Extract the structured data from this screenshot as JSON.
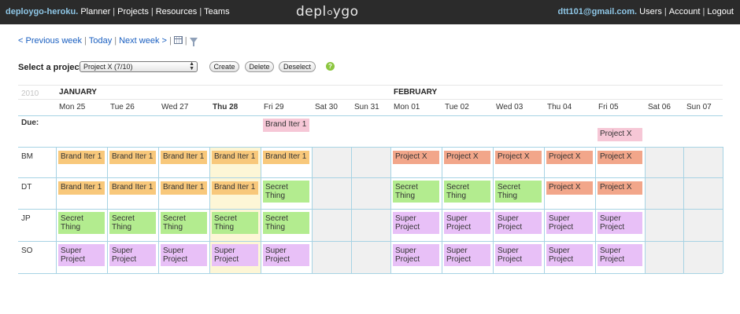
{
  "topbar": {
    "site": "deploygo-heroku.",
    "nav": [
      "Planner",
      "Projects",
      "Resources",
      "Teams"
    ],
    "logo_left": "depl",
    "logo_right": "ygo",
    "email": "dtt101@gmail.com.",
    "user_links": [
      "Users",
      "Account",
      "Logout"
    ]
  },
  "weeknav": {
    "prev": "< Previous week",
    "today": "Today",
    "next": "Next week >",
    "sep": "|"
  },
  "project": {
    "label": "Select a project:",
    "selected": "Project X (7/10)",
    "buttons": [
      "Create",
      "Delete",
      "Deselect"
    ],
    "help": "?"
  },
  "calendar": {
    "year": "2010",
    "months": [
      "JANUARY",
      "FEBRUARY"
    ],
    "days": [
      "Mon 25",
      "Tue 26",
      "Wed 27",
      "Thu 28",
      "Fri 29",
      "Sat 30",
      "Sun 31",
      "Mon 01",
      "Tue 02",
      "Wed 03",
      "Thu 04",
      "Fri 05",
      "Sat 06",
      "Sun 07"
    ],
    "today_label": "Thu 28",
    "weekend_labels": [
      "Sat 30",
      "Sun 31",
      "Sat 06",
      "Sun 07"
    ],
    "rows": [
      "Due:",
      "BM",
      "DT",
      "JP",
      "SO"
    ],
    "due": [
      {
        "day": "Fri 29",
        "text": "Brand Iter 1",
        "color": "#f6c7d6"
      },
      {
        "day": "Fri 05",
        "text": "Project X",
        "color": "#f6c7d6"
      }
    ],
    "assignments": {
      "BM": [
        {
          "day": "Mon 25",
          "text": "Brand Iter 1"
        },
        {
          "day": "Tue 26",
          "text": "Brand Iter 1"
        },
        {
          "day": "Wed 27",
          "text": "Brand Iter 1"
        },
        {
          "day": "Thu 28",
          "text": "Brand Iter 1"
        },
        {
          "day": "Fri 29",
          "text": "Brand Iter 1"
        },
        {
          "day": "Mon 01",
          "text": "Project X"
        },
        {
          "day": "Tue 02",
          "text": "Project X"
        },
        {
          "day": "Wed 03",
          "text": "Project X"
        },
        {
          "day": "Thu 04",
          "text": "Project X"
        },
        {
          "day": "Fri 05",
          "text": "Project X"
        }
      ],
      "DT": [
        {
          "day": "Mon 25",
          "text": "Brand Iter 1"
        },
        {
          "day": "Tue 26",
          "text": "Brand Iter 1"
        },
        {
          "day": "Wed 27",
          "text": "Brand Iter 1"
        },
        {
          "day": "Thu 28",
          "text": "Brand Iter 1"
        },
        {
          "day": "Fri 29",
          "text": "Secret Thing"
        },
        {
          "day": "Mon 01",
          "text": "Secret Thing"
        },
        {
          "day": "Tue 02",
          "text": "Secret Thing"
        },
        {
          "day": "Wed 03",
          "text": "Secret Thing"
        },
        {
          "day": "Thu 04",
          "text": "Project X"
        },
        {
          "day": "Fri 05",
          "text": "Project X"
        }
      ],
      "JP": [
        {
          "day": "Mon 25",
          "text": "Secret Thing"
        },
        {
          "day": "Tue 26",
          "text": "Secret Thing"
        },
        {
          "day": "Wed 27",
          "text": "Secret Thing"
        },
        {
          "day": "Thu 28",
          "text": "Secret Thing"
        },
        {
          "day": "Fri 29",
          "text": "Secret Thing"
        },
        {
          "day": "Mon 01",
          "text": "Super Project"
        },
        {
          "day": "Tue 02",
          "text": "Super Project"
        },
        {
          "day": "Wed 03",
          "text": "Super Project"
        },
        {
          "day": "Thu 04",
          "text": "Super Project"
        },
        {
          "day": "Fri 05",
          "text": "Super Project"
        }
      ],
      "SO": [
        {
          "day": "Mon 25",
          "text": "Super Project"
        },
        {
          "day": "Tue 26",
          "text": "Super Project"
        },
        {
          "day": "Wed 27",
          "text": "Super Project"
        },
        {
          "day": "Thu 28",
          "text": "Super Project"
        },
        {
          "day": "Fri 29",
          "text": "Super Project"
        },
        {
          "day": "Mon 01",
          "text": "Super Project"
        },
        {
          "day": "Tue 02",
          "text": "Super Project"
        },
        {
          "day": "Wed 03",
          "text": "Super Project"
        },
        {
          "day": "Thu 04",
          "text": "Super Project"
        },
        {
          "day": "Fri 05",
          "text": "Super Project"
        }
      ]
    },
    "project_colors": {
      "Brand Iter 1": "#f8c87b",
      "Secret Thing": "#b3ec8f",
      "Super Project": "#e8c0f7",
      "Project X": "#f2a68a"
    },
    "colors": {
      "grid_line": "#a7d3e4",
      "weekend": "#f0f0f0",
      "today": "#fdf6d6",
      "link": "#1a5fc0",
      "topbar": "#2b2b2b"
    }
  }
}
